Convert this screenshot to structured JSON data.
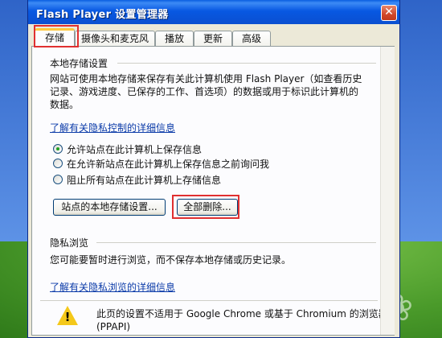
{
  "window": {
    "title": "Flash Player 设置管理器",
    "close_glyph": "✕"
  },
  "tabs": [
    {
      "label": "存储",
      "active": true
    },
    {
      "label": "摄像头和麦克风",
      "active": false
    },
    {
      "label": "播放",
      "active": false
    },
    {
      "label": "更新",
      "active": false
    },
    {
      "label": "高级",
      "active": false
    }
  ],
  "local_storage": {
    "heading": "本地存储设置",
    "description_line1": "网站可使用本地存储来保存有关此计算机使用 Flash Player（如查看历史",
    "description_line2": "记录、游戏进度、已保存的工作、首选项）的数据或用于标识此计算机的",
    "description_line3": "数据。",
    "privacy_link": "了解有关隐私控制的详细信息",
    "options": [
      {
        "label": "允许站点在此计算机上保存信息",
        "checked": true
      },
      {
        "label": "在允许新站点在此计算机上保存信息之前询问我",
        "checked": false
      },
      {
        "label": "阻止所有站点在此计算机上存储信息",
        "checked": false
      }
    ],
    "site_settings_button": "站点的本地存储设置...",
    "delete_all_button": "全部删除..."
  },
  "private_browsing": {
    "heading": "隐私浏览",
    "description": "您可能要暂时进行浏览，而不保存本地存储或历史记录。",
    "link": "了解有关隐私浏览的详细信息"
  },
  "notice": {
    "line1": "此页的设置不适用于 Google Chrome 或基于 Chromium 的浏览器",
    "line2": "(PPAPI)",
    "icon": "warning-icon"
  },
  "highlight_color": "#e03030"
}
